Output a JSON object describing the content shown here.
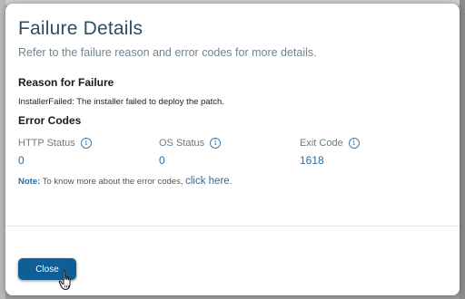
{
  "dialog": {
    "title": "Failure Details",
    "subtitle": "Refer to the failure reason and error codes for more details."
  },
  "reason": {
    "heading": "Reason for Failure",
    "text": "InstallerFailed: The installer failed to deploy the patch."
  },
  "error_codes": {
    "heading": "Error Codes",
    "items": [
      {
        "label": "HTTP Status",
        "value": "0",
        "icon": "info-icon"
      },
      {
        "label": "OS Status",
        "value": "0",
        "icon": "info-icon"
      },
      {
        "label": "Exit Code",
        "value": "1618",
        "icon": "info-icon"
      }
    ]
  },
  "note": {
    "label": "Note:",
    "text": "To know more about the error codes,",
    "link_text": "click here",
    "suffix": "."
  },
  "footer": {
    "close_label": "Close"
  },
  "colors": {
    "title": "#2f4f5f",
    "accent": "#2b6aa3",
    "button": "#0f5f97"
  }
}
